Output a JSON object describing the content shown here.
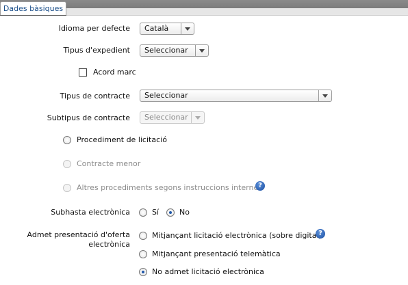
{
  "tabs": {
    "active_label": "Dades bàsiques"
  },
  "form": {
    "idioma": {
      "label": "Idioma per defecte",
      "value": "Català"
    },
    "tipus_expedient": {
      "label": "Tipus d'expedient",
      "value": "Seleccionar"
    },
    "acord_marc": {
      "label": "Acord marc",
      "checked": false
    },
    "tipus_contracte": {
      "label": "Tipus de contracte",
      "value": "Seleccionar"
    },
    "subtipus_contracte": {
      "label": "Subtipus de contracte",
      "value": "Seleccionar",
      "disabled": true
    },
    "procediment": {
      "options": [
        {
          "label": "Procediment de licitació",
          "disabled": false,
          "checked": false
        },
        {
          "label": "Contracte menor",
          "disabled": true,
          "checked": false
        },
        {
          "label": "Altres procediments segons instruccions internes",
          "disabled": true,
          "checked": false
        }
      ]
    },
    "subhasta": {
      "label": "Subhasta electrònica",
      "options": [
        {
          "label": "Sí",
          "checked": false
        },
        {
          "label": "No",
          "checked": true
        }
      ]
    },
    "presentacio": {
      "label_line1": "Admet presentació d'oferta",
      "label_line2": "electrònica",
      "options": [
        {
          "label": "Mitjançant licitació electrònica (sobre digital)",
          "checked": false
        },
        {
          "label": "Mitjançant presentació telemàtica",
          "checked": false
        },
        {
          "label": "No admet licitació electrònica",
          "checked": true
        }
      ]
    }
  },
  "help_icon_glyph": "?",
  "colors": {
    "tab_text": "#1b4f8a",
    "help_icon": "#1b4fa3",
    "radio_dot": "#1e56a8"
  }
}
